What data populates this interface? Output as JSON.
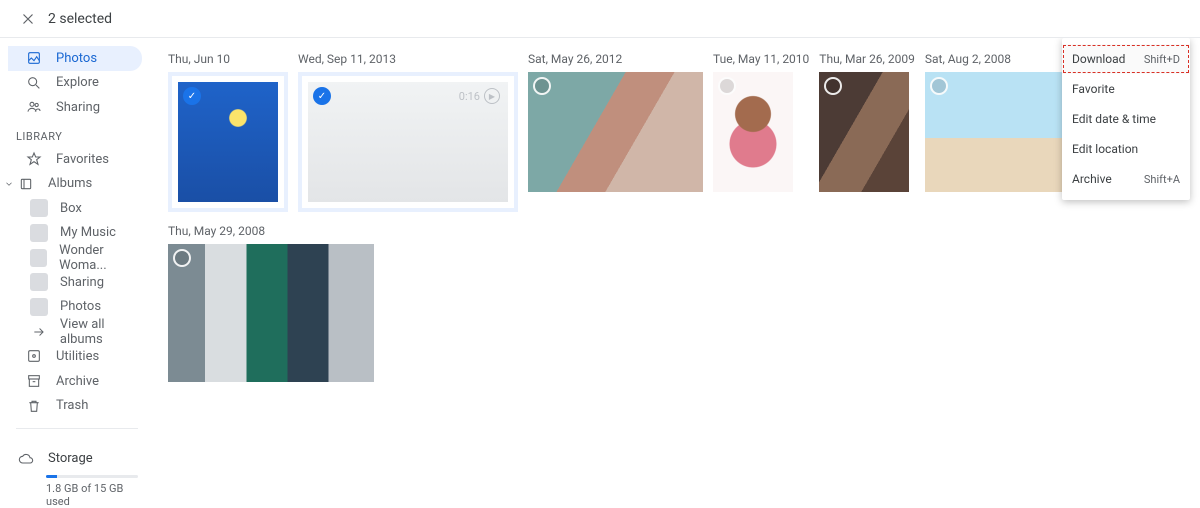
{
  "header": {
    "selected_text": "2 selected"
  },
  "sidebar": {
    "nav": [
      {
        "label": "Photos"
      },
      {
        "label": "Explore"
      },
      {
        "label": "Sharing"
      }
    ],
    "library_title": "LIBRARY",
    "library": [
      {
        "label": "Favorites"
      },
      {
        "label": "Albums"
      }
    ],
    "albums_sub": [
      {
        "label": "Box"
      },
      {
        "label": "My Music"
      },
      {
        "label": "Wonder Woma..."
      },
      {
        "label": "Sharing"
      },
      {
        "label": "Photos"
      },
      {
        "label": "View all albums"
      }
    ],
    "tools": [
      {
        "label": "Utilities"
      },
      {
        "label": "Archive"
      },
      {
        "label": "Trash"
      }
    ],
    "storage_label": "Storage",
    "storage_text": "1.8 GB of 15 GB used"
  },
  "photos": {
    "groups": [
      {
        "date": "Thu, Jun 10",
        "selected": true
      },
      {
        "date": "Wed, Sep 11, 2013",
        "selected": true,
        "video_duration": "0:16"
      },
      {
        "date": "Sat, May 26, 2012",
        "selected": false
      },
      {
        "date": "Tue, May 11, 2010",
        "selected": false
      },
      {
        "date": "Thu, Mar 26, 2009",
        "selected": false
      },
      {
        "date": "Sat, Aug 2, 2008",
        "selected": false
      }
    ],
    "group2": {
      "date": "Thu, May 29, 2008",
      "selected": false
    }
  },
  "context_menu": [
    {
      "label": "Download",
      "shortcut": "Shift+D"
    },
    {
      "label": "Favorite",
      "shortcut": ""
    },
    {
      "label": "Edit date & time",
      "shortcut": ""
    },
    {
      "label": "Edit location",
      "shortcut": ""
    },
    {
      "label": "Archive",
      "shortcut": "Shift+A"
    }
  ]
}
